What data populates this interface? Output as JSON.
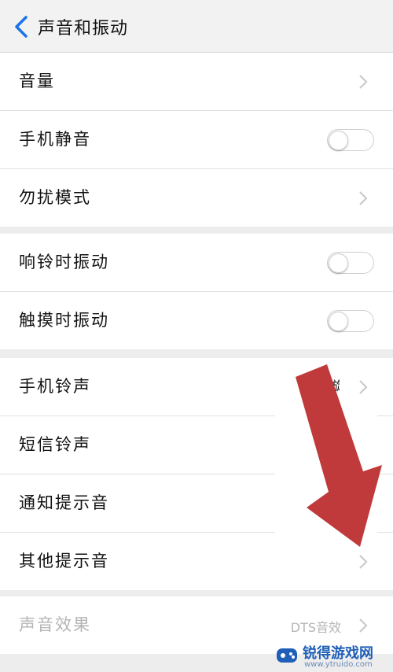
{
  "header": {
    "title": "声音和振动"
  },
  "groups": [
    {
      "items": [
        {
          "label": "音量",
          "control": "chevron"
        },
        {
          "label": "手机静音",
          "control": "toggle",
          "on": false
        },
        {
          "label": "勿扰模式",
          "control": "chevron"
        }
      ]
    },
    {
      "items": [
        {
          "label": "响铃时振动",
          "control": "toggle",
          "on": false
        },
        {
          "label": "触摸时振动",
          "control": "toggle",
          "on": false
        }
      ]
    },
    {
      "items": [
        {
          "label": "手机铃声",
          "value": "旋",
          "control": "chevron"
        },
        {
          "label": "短信铃声",
          "control": "chevron"
        },
        {
          "label": "通知提示音",
          "control": "chevron"
        },
        {
          "label": "其他提示音",
          "control": "chevron"
        }
      ]
    },
    {
      "items": [
        {
          "label": "声音效果",
          "value": "DTS音效",
          "control": "chevron",
          "disabled": true
        }
      ]
    }
  ],
  "watermark": {
    "name": "锐得游戏网",
    "url": "www.ytruido.com"
  },
  "colors": {
    "accent": "#1a73e8",
    "arrow": "#c0393b",
    "chevron": "#c7c7cc"
  }
}
